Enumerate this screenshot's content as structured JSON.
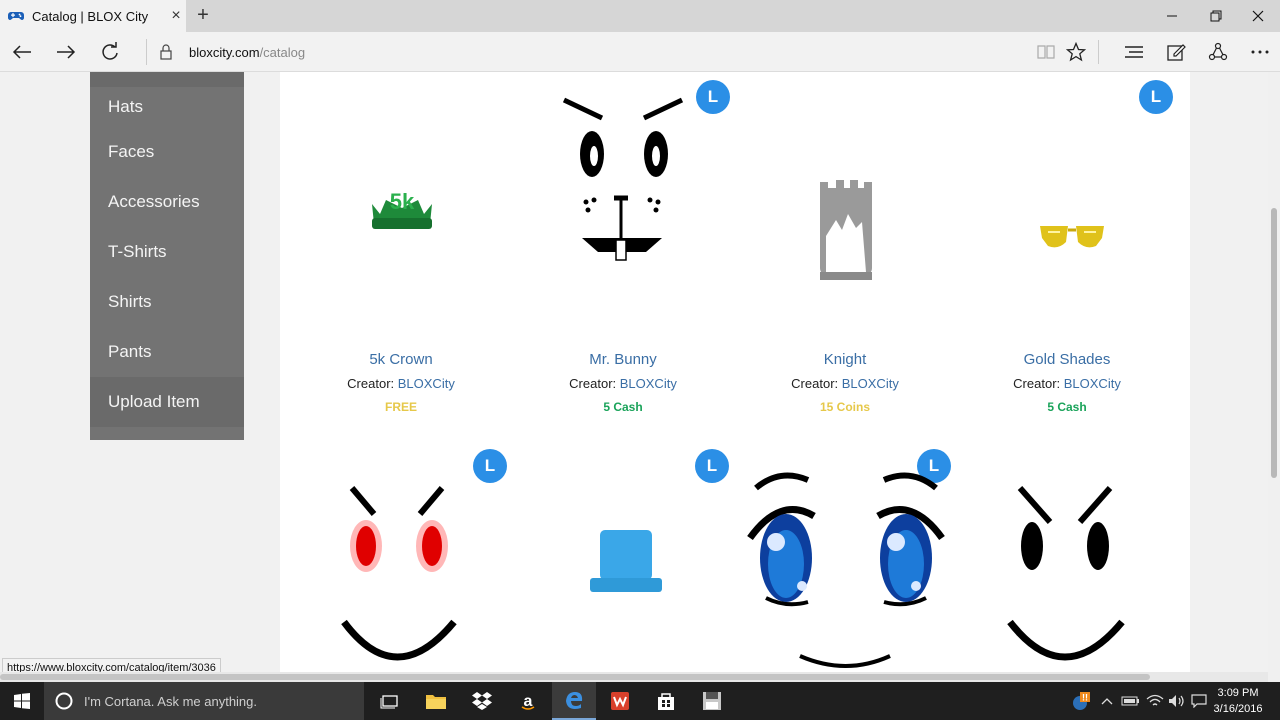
{
  "browser": {
    "tab_title": "Catalog | BLOX City",
    "tab_close": "×",
    "new_tab": "+",
    "address_host": "bloxcity.com",
    "address_path": "/catalog",
    "status_url": "https://www.bloxcity.com/catalog/item/3036"
  },
  "sidebar": {
    "items": [
      {
        "label": "Hats"
      },
      {
        "label": "Faces"
      },
      {
        "label": "Accessories"
      },
      {
        "label": "T-Shirts"
      },
      {
        "label": "Shirts"
      },
      {
        "label": "Pants"
      },
      {
        "label": "Upload Item"
      }
    ]
  },
  "catalog": {
    "creator_prefix": "Creator: ",
    "badge_label": "L",
    "items": [
      {
        "name": "5k Crown",
        "creator": "BLOXCity",
        "price": "FREE",
        "price_color": "#e6c84a"
      },
      {
        "name": "Mr. Bunny",
        "creator": "BLOXCity",
        "price": "5 Cash",
        "price_color": "#1aa35a"
      },
      {
        "name": "Knight",
        "creator": "BLOXCity",
        "price": "15 Coins",
        "price_color": "#e6c84a"
      },
      {
        "name": "Gold Shades",
        "creator": "BLOXCity",
        "price": "5 Cash",
        "price_color": "#1aa35a"
      }
    ]
  },
  "taskbar": {
    "cortana_text": "I'm Cortana. Ask me anything.",
    "time": "3:09 PM",
    "date": "3/16/2016"
  },
  "colors": {
    "accent_blue": "#2b8fe6",
    "link_blue": "#3a6ea5",
    "sidebar_gray": "#737373"
  }
}
